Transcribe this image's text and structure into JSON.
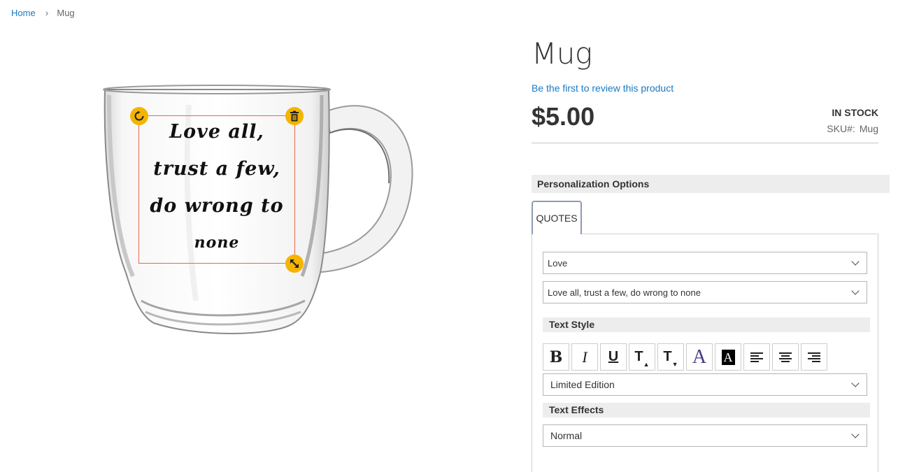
{
  "breadcrumb": {
    "home": "Home",
    "current": "Mug"
  },
  "product": {
    "title": "Mug",
    "review_link": "Be the first to review this product",
    "price": "$5.00",
    "stock": "IN STOCK",
    "sku_label": "SKU#:",
    "sku_value": "Mug"
  },
  "design": {
    "quote_lines": [
      "Love all,",
      "trust a few,",
      "do wrong to",
      "none"
    ]
  },
  "personalization": {
    "heading": "Personalization Options",
    "tab_label": "QUOTES",
    "category_select": "Love",
    "quote_select": "Love all, trust a few, do wrong to none",
    "text_style_heading": "Text Style",
    "font_select": "Limited Edition",
    "text_effects_heading": "Text Effects",
    "effect_select": "Normal"
  },
  "toolbar": {
    "bold": "B",
    "italic": "I",
    "underline": "U",
    "text_size_up": "T",
    "text_size_down": "T",
    "text_color": "A",
    "text_bg_color": "A"
  },
  "colors": {
    "link": "#1979c3",
    "handle": "#f5b400",
    "design_border": "#e9674a",
    "tab_border": "#8f9bb5"
  }
}
